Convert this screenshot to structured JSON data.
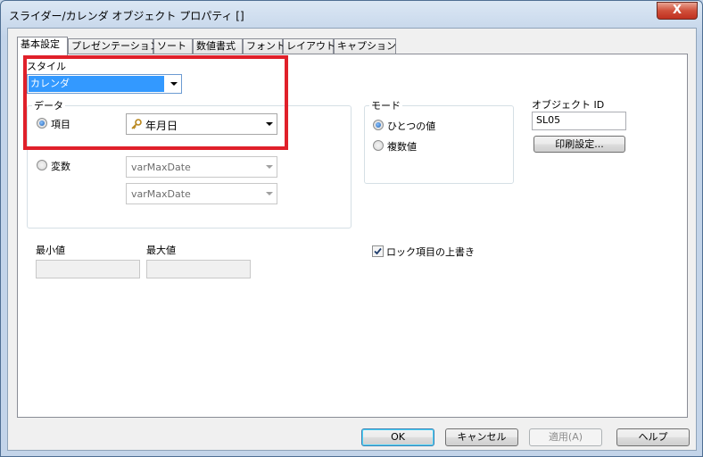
{
  "window": {
    "title": "スライダー/カレンダ オブジェクト プロパティ []",
    "close_glyph": "X"
  },
  "tabs": [
    "基本設定",
    "プレゼンテーション",
    "ソート",
    "数値書式",
    "フォント",
    "レイアウト",
    "キャプション"
  ],
  "style": {
    "label": "スタイル",
    "value": "カレンダ"
  },
  "data_group": {
    "label": "データ",
    "field_radio": "項目",
    "field_value": "年月日",
    "variable_radio": "変数",
    "variable_1": "varMaxDate",
    "variable_2": "varMaxDate"
  },
  "mode_group": {
    "label": "モード",
    "single": "ひとつの値",
    "multi": "複数値"
  },
  "object_id": {
    "label": "オブジェクト ID",
    "value": "SL05"
  },
  "print_button": "印刷設定...",
  "min_label": "最小値",
  "max_label": "最大値",
  "lock_override": "ロック項目の上書き",
  "buttons": {
    "ok": "OK",
    "cancel": "キャンセル",
    "apply": "適用(A)",
    "help": "ヘルプ"
  },
  "colors": {
    "highlight": "#e0202a",
    "selection": "#3399ff"
  }
}
